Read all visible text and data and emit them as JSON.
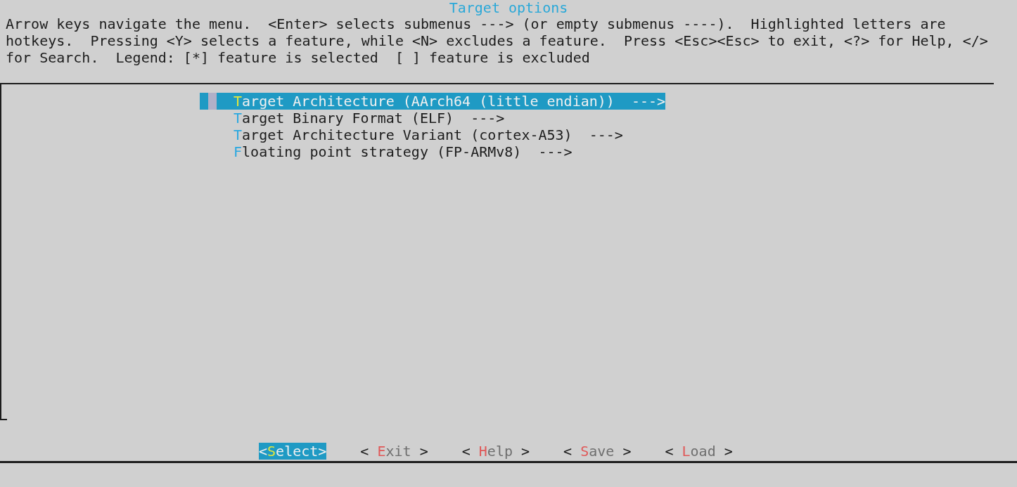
{
  "title": "Target options",
  "help_lines": [
    "Arrow keys navigate the menu.  <Enter> selects submenus ---> (or empty submenus ----).  Highlighted letters are",
    "hotkeys.  Pressing <Y> selects a feature, while <N> excludes a feature.  Press <Esc><Esc> to exit, <?> for Help, </>",
    "for Search.  Legend: [*] feature is selected  [ ] feature is excluded"
  ],
  "menu_items": [
    {
      "hotkey": "T",
      "text": "arget Architecture (AArch64 (little endian))  --->",
      "selected": true
    },
    {
      "hotkey": "T",
      "text": "arget Binary Format (ELF)  --->",
      "selected": false
    },
    {
      "hotkey": "T",
      "text": "arget Architecture Variant (cortex-A53)  --->",
      "selected": false
    },
    {
      "hotkey": "F",
      "text": "loating point strategy (FP-ARMv8)  --->",
      "selected": false
    }
  ],
  "buttons": [
    {
      "open": "<",
      "hotkey": "S",
      "text": "elect",
      "close": ">",
      "selected": true
    },
    {
      "open": "< ",
      "hotkey": "E",
      "text": "xit",
      "close": " >",
      "selected": false
    },
    {
      "open": "< ",
      "hotkey": "H",
      "text": "elp",
      "close": " >",
      "selected": false
    },
    {
      "open": "< ",
      "hotkey": "S",
      "text": "ave",
      "close": " >",
      "selected": false
    },
    {
      "open": "< ",
      "hotkey": "L",
      "text": "oad",
      "close": " >",
      "selected": false
    }
  ]
}
